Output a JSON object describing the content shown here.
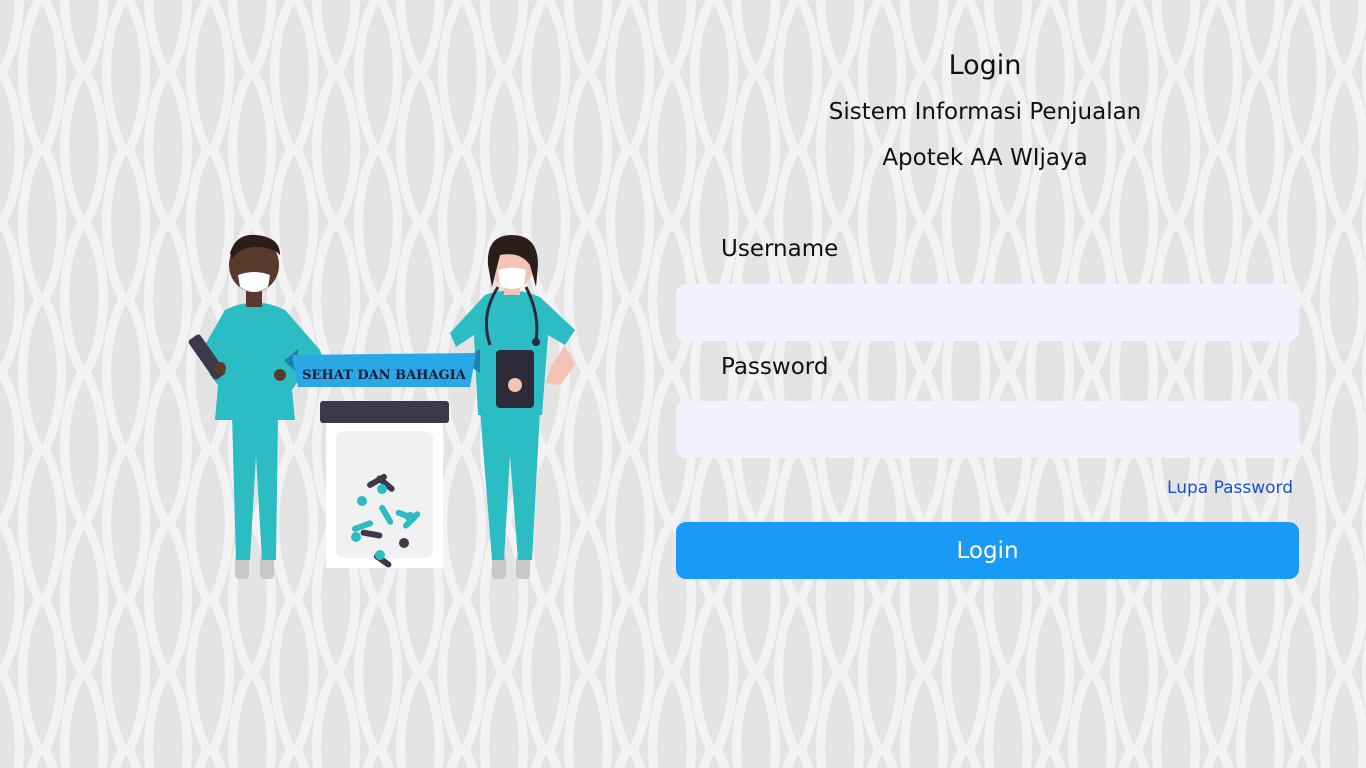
{
  "header": {
    "title": "Login",
    "subtitle_line1": "Sistem Informasi Penjualan",
    "subtitle_line2": "Apotek AA WIjaya"
  },
  "form": {
    "username_label": "Username",
    "username_value": "",
    "username_placeholder": "",
    "password_label": "Password",
    "password_value": "",
    "password_placeholder": "",
    "forgot_label": "Lupa Password",
    "submit_label": "Login"
  },
  "illustration": {
    "banner_text": "SEHAT DAN BAHAGIA"
  },
  "colors": {
    "background": "#e4e4e4",
    "pattern": "#f3f3f3",
    "primary_button": "#1a9af7",
    "link": "#1a4fd0",
    "input_bg": "#f4f3fd",
    "scrubs": "#2bbcc4"
  }
}
